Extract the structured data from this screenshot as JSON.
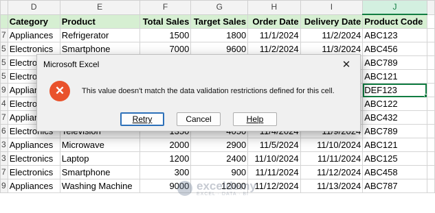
{
  "columns": [
    "D",
    "E",
    "F",
    "G",
    "H",
    "I",
    "J"
  ],
  "selected_column": "J",
  "headers": [
    "Category",
    "Product",
    "Total Sales",
    "Target Sales",
    "Order Date",
    "Delivery Date",
    "Product Code"
  ],
  "rows": [
    {
      "row": "7",
      "category": "Appliances",
      "product": "Refrigerator",
      "total": "1500",
      "target": "1800",
      "order": "11/1/2024",
      "delivery": "11/2/2024",
      "code": "ABC123"
    },
    {
      "row": "5",
      "category": "Electronics",
      "product": "Smartphone",
      "total": "7000",
      "target": "9600",
      "order": "11/2/2024",
      "delivery": "11/3/2024",
      "code": "ABC456"
    },
    {
      "row": "5",
      "category": "Electron",
      "product": "",
      "total": "",
      "target": "",
      "order": "",
      "delivery": "",
      "code": "ABC789"
    },
    {
      "row": "5",
      "category": "Electron",
      "product": "",
      "total": "",
      "target": "",
      "order": "",
      "delivery": "",
      "code": "ABC121"
    },
    {
      "row": "9",
      "category": "Applian",
      "product": "",
      "total": "",
      "target": "",
      "order": "",
      "delivery": "",
      "code": "DEF123"
    },
    {
      "row": "4",
      "category": "Electron",
      "product": "",
      "total": "",
      "target": "",
      "order": "",
      "delivery": "",
      "code": "ABC122"
    },
    {
      "row": "7",
      "category": "Applian",
      "product": "",
      "total": "",
      "target": "",
      "order": "",
      "delivery": "",
      "code": "ABC432"
    },
    {
      "row": "6",
      "category": "Electronics",
      "product": "Television",
      "total": "1350",
      "target": "4050",
      "order": "11/4/2024",
      "delivery": "11/9/2024",
      "code": "ABC789"
    },
    {
      "row": "3",
      "category": "Appliances",
      "product": "Microwave",
      "total": "2000",
      "target": "2900",
      "order": "11/5/2024",
      "delivery": "11/10/2024",
      "code": "ABC121"
    },
    {
      "row": "3",
      "category": "Electronics",
      "product": "Laptop",
      "total": "1200",
      "target": "2400",
      "order": "11/10/2024",
      "delivery": "11/11/2024",
      "code": "ABC125"
    },
    {
      "row": "7",
      "category": "Electronics",
      "product": "Smartphone",
      "total": "300",
      "target": "900",
      "order": "11/11/2024",
      "delivery": "11/12/2024",
      "code": "ABC458"
    },
    {
      "row": "9",
      "category": "Appliances",
      "product": "Washing Machine",
      "total": "9000",
      "target": "12000",
      "order": "11/12/2024",
      "delivery": "11/13/2024",
      "code": "ABC787"
    }
  ],
  "dialog": {
    "title": "Microsoft Excel",
    "close_glyph": "✕",
    "icon_glyph": "✕",
    "message": "This value doesn't match the data validation restrictions defined for this cell.",
    "buttons": {
      "retry": "Retry",
      "cancel": "Cancel",
      "help": "Help"
    }
  },
  "watermark": {
    "main": "exceldemy",
    "sub": "EXCEL · DATA · BI"
  },
  "colors": {
    "header_fill": "#d6efd2",
    "accent": "#107c41",
    "error_icon": "#e9522c"
  }
}
